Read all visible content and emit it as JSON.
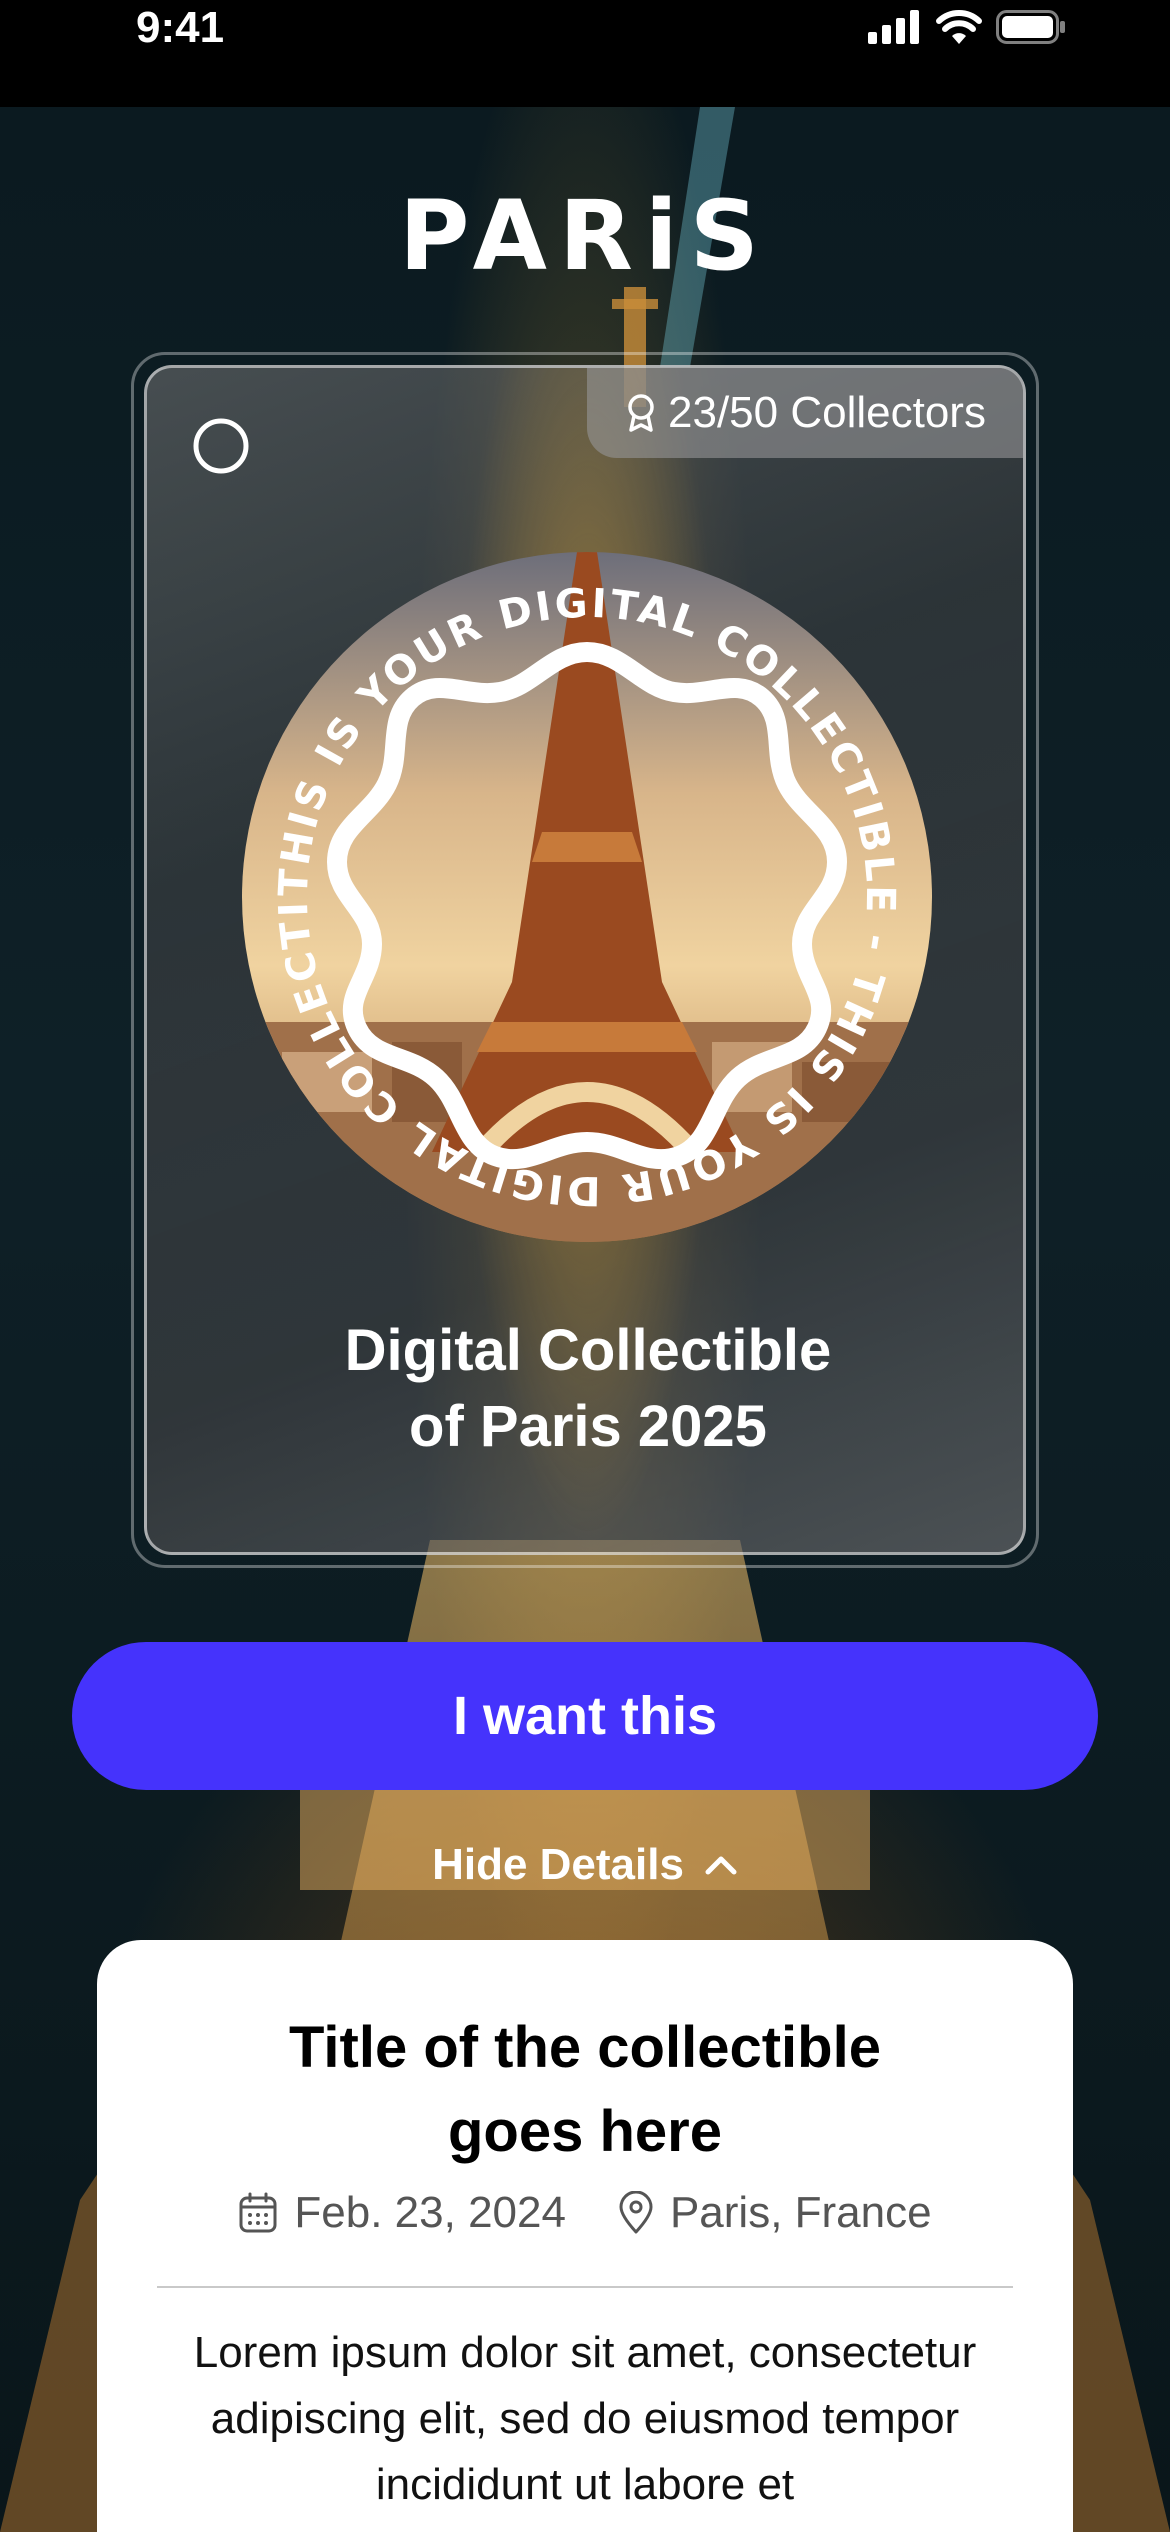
{
  "status_bar": {
    "time": "9:41"
  },
  "header": {
    "logo": "PARiS"
  },
  "card": {
    "collectors_count": "23/50 Collectors",
    "medallion_ring_text": "THIS IS YOUR DIGITAL COLLECTIBLE - THIS IS YOUR DIGITAL COLLECTIBLE - ",
    "title_line1": "Digital Collectible",
    "title_line2": "of Paris 2025"
  },
  "cta": {
    "label": "I want this"
  },
  "details_toggle": {
    "label": "Hide Details"
  },
  "details": {
    "title_line1": "Title of the collectible",
    "title_line2": "goes here",
    "date": "Feb. 23, 2024",
    "location": "Paris, France",
    "description": "Lorem ipsum dolor sit amet, consectetur adipiscing elit, sed do eiusmod tempor incididunt ut labore et"
  },
  "colors": {
    "accent": "#4533fc",
    "glow": "#d6a037"
  },
  "icons": [
    "signal-icon",
    "wifi-icon",
    "battery-icon",
    "ring-icon",
    "award-icon",
    "chevron-up-icon",
    "calendar-icon",
    "location-pin-icon"
  ]
}
